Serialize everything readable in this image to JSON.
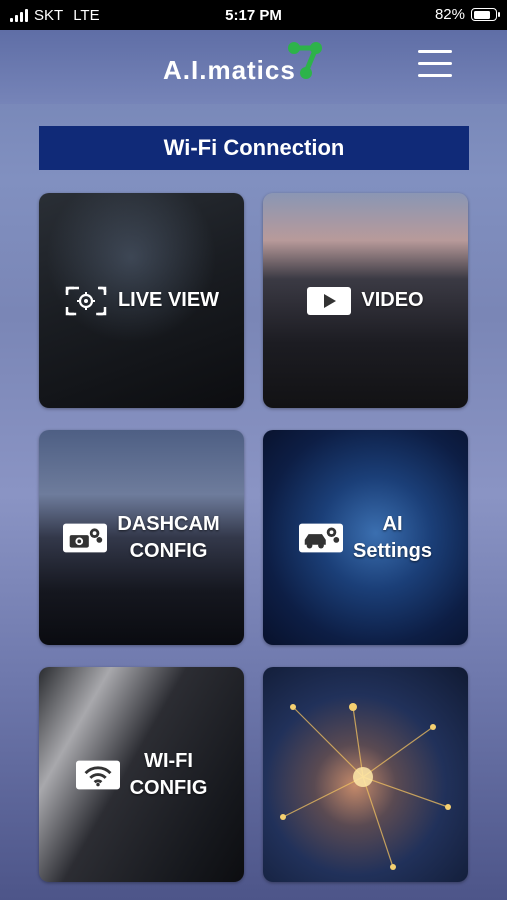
{
  "status_bar": {
    "carrier": "SKT",
    "network": "LTE",
    "time": "5:17 PM",
    "battery_percent": "82%",
    "battery_level": 0.82
  },
  "header": {
    "logo_text": "A.I.matics",
    "logo_accent_color": "#2db34a",
    "menu_icon": "hamburger-menu-icon"
  },
  "banner": {
    "title": "Wi-Fi Connection",
    "background_color": "#102a78"
  },
  "tiles": [
    {
      "label": "LIVE VIEW",
      "icon": "live-view-icon"
    },
    {
      "label": "VIDEO",
      "icon": "play-icon"
    },
    {
      "label": "DASHCAM\nCONFIG",
      "icon": "camera-settings-icon"
    },
    {
      "label": "AI\nSettings",
      "icon": "car-settings-icon"
    },
    {
      "label": "WI-FI\nCONFIG",
      "icon": "wifi-icon"
    },
    {
      "label": "",
      "icon": ""
    }
  ]
}
